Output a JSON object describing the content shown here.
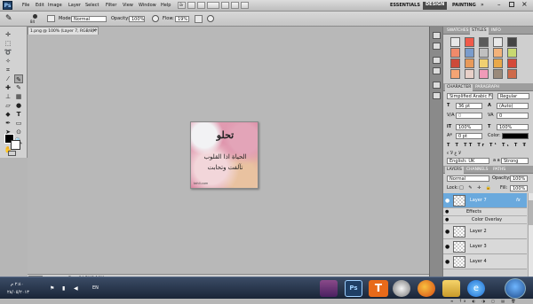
{
  "app": {
    "logo": "Ps"
  },
  "menu": [
    "File",
    "Edit",
    "Image",
    "Layer",
    "Select",
    "Filter",
    "View",
    "Window",
    "Help"
  ],
  "workspaces": {
    "essentials": "ESSENTIALS",
    "design": "DESIGN",
    "painting": "PAINTING"
  },
  "options": {
    "brush_size": "84",
    "mode_label": "Mode:",
    "mode_value": "Normal",
    "opacity_label": "Opacity:",
    "opacity_value": "100%",
    "flow_label": "Flow:",
    "flow_value": "19%"
  },
  "document": {
    "tab_title": "1.png @ 100% (Layer 7, RGB/8) *",
    "title_word": "تحلو",
    "line1": "الحياة اذا القلوب",
    "line2": "تآلفت وتحابت",
    "watermark": "tahli.com"
  },
  "status": {
    "zoom": "100%",
    "doc": "Doc: 84.7K/3.10M"
  },
  "swatches_panel": {
    "tabs": [
      "SWATCHES",
      "STYLES",
      "INFO"
    ],
    "colors": [
      "#e7e7e7",
      "#f05a4a",
      "#5a5a5a",
      "#e8e8e8",
      "#444444",
      "#f08a6a",
      "#7a9ccc",
      "#c0c0c0",
      "#f3b27a",
      "#c8d870",
      "#cc4a3a",
      "#e89a5a",
      "#f0d070",
      "#e8a84a",
      "#d44a3a",
      "#f4a474",
      "#e8d0c8",
      "#f09ab8",
      "#9a8a7a",
      "#ce6a4a"
    ]
  },
  "character": {
    "tabs": [
      "CHARACTER",
      "PARAGRAPH"
    ],
    "font": "Simplified Arabic Fi...",
    "style": "Regular",
    "size": "36 pt",
    "leading": "(Auto)",
    "kerning": "0",
    "tracking": "0",
    "vscale": "100%",
    "hscale": "100%",
    "baseline": "0 pt",
    "color_label": "Color:",
    "language": "English: UK",
    "antialias": "Strong",
    "aa_label": "a a"
  },
  "layers": {
    "tabs": [
      "LAYERS",
      "CHANNELS",
      "PATHS"
    ],
    "blend_mode": "Normal",
    "opacity_label": "Opacity:",
    "opacity_value": "100%",
    "lock_label": "Lock:",
    "fill_label": "Fill:",
    "fill_value": "100%",
    "items": [
      {
        "name": "Layer 7",
        "selected": true,
        "fx": "fx"
      },
      {
        "name": "Layer 2",
        "selected": false
      },
      {
        "name": "Layer 3",
        "selected": false
      },
      {
        "name": "Layer 4",
        "selected": false
      }
    ],
    "effects_label": "Effects",
    "color_overlay": "Color Overlay"
  },
  "taskbar": {
    "lang": "EN",
    "time": "٢:٤٠ م",
    "date": "٢٨/٠٥/٢٠١٣"
  },
  "colors": {
    "selected_layer": "#6aa9dd",
    "design_tab": "#4a4a4a"
  }
}
